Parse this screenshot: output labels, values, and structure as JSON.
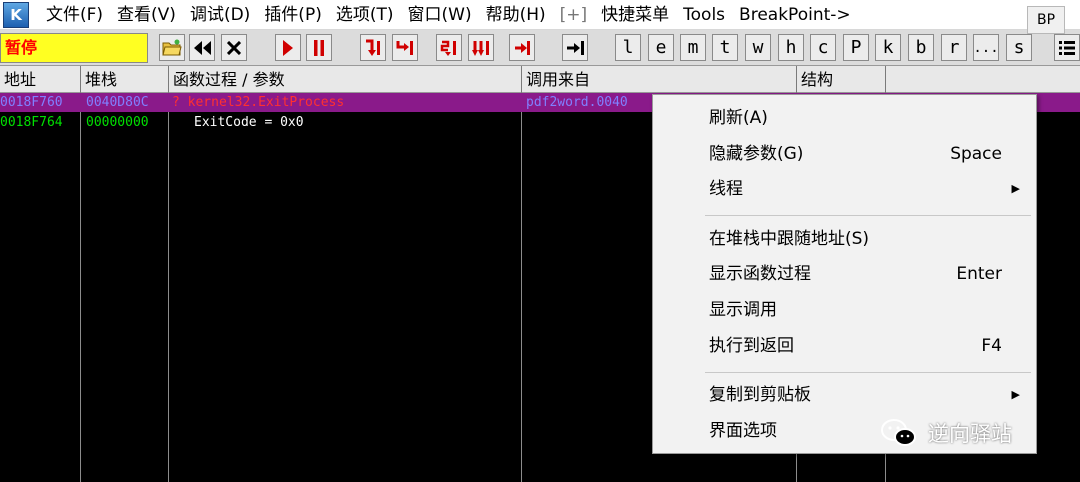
{
  "app": {
    "icon_letter": "K"
  },
  "menubar": {
    "items": [
      "文件(F)",
      "查看(V)",
      "调试(D)",
      "插件(P)",
      "选项(T)",
      "窗口(W)",
      "帮助(H)",
      "[+]",
      "快捷菜单",
      "Tools",
      "BreakPoint->"
    ],
    "bp_button": "BP"
  },
  "toolbar": {
    "status": "暂停",
    "letters": [
      "l",
      "e",
      "m",
      "t",
      "w",
      "h",
      "c",
      "P",
      "k",
      "b",
      "r",
      "...",
      "s"
    ],
    "icons": [
      "open-icon",
      "rewind-icon",
      "close-icon",
      "run-icon",
      "pause-icon",
      "step-into-icon",
      "step-over-icon",
      "trace-into-icon",
      "trace-over-icon",
      "execute-till-return-icon",
      "goto-icon",
      "list-icon"
    ]
  },
  "table": {
    "columns": [
      "地址",
      "堆栈",
      "函数过程 / 参数",
      "调用来自",
      "结构"
    ],
    "rows": [
      {
        "address": "0018F760",
        "stack": "0040D80C",
        "func": "? kernel32.ExitProcess",
        "caller": "pdf2word.0040",
        "frame": ""
      },
      {
        "address": "0018F764",
        "stack": "00000000",
        "func": "ExitCode = 0x0",
        "caller": "",
        "frame": ""
      }
    ]
  },
  "context_menu": {
    "items": [
      {
        "label": "刷新(A)",
        "shortcut": ""
      },
      {
        "label": "隐藏参数(G)",
        "shortcut": "Space"
      },
      {
        "label": "线程",
        "shortcut": "",
        "arrow": "▶"
      },
      {
        "label": "在堆栈中跟随地址(S)",
        "shortcut": ""
      },
      {
        "label": "显示函数过程",
        "shortcut": "Enter"
      },
      {
        "label": "显示调用",
        "shortcut": ""
      },
      {
        "label": "执行到返回",
        "shortcut": "F4"
      },
      {
        "label": "复制到剪贴板",
        "shortcut": "",
        "arrow": "▶"
      },
      {
        "label": "界面选项",
        "shortcut": ""
      }
    ]
  },
  "watermark": {
    "text": "逆向驿站"
  },
  "colors": {
    "status_bg": "#ffff22",
    "status_text": "#ff0000",
    "selected_row": "#8a1a8a",
    "row0_text": "#8080ff",
    "row1_text": "#00e000",
    "func_red": "#ff3030"
  }
}
